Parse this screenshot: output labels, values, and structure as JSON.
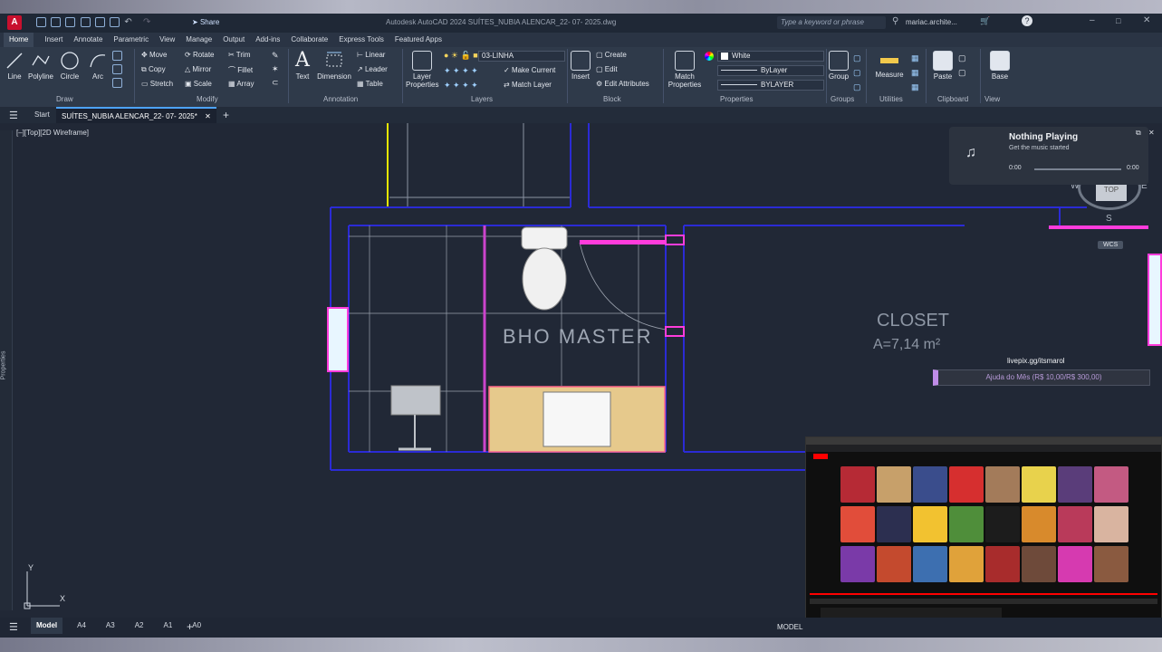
{
  "app": {
    "logo_letter": "A",
    "title": "Autodesk AutoCAD 2024   SUÍTES_NUBIA ALENCAR_22- 07- 2025.dwg",
    "search_placeholder": "Type a keyword or phrase",
    "user": "mariac.archite...",
    "share_label": "Share"
  },
  "ribbon_tabs": [
    "Home",
    "Insert",
    "Annotate",
    "Parametric",
    "View",
    "Manage",
    "Output",
    "Add-ins",
    "Collaborate",
    "Express Tools",
    "Featured Apps"
  ],
  "active_tab": "Home",
  "draw": {
    "line": "Line",
    "polyline": "Polyline",
    "circle": "Circle",
    "arc": "Arc",
    "panel": "Draw"
  },
  "modify": {
    "move": "Move",
    "rotate": "Rotate",
    "trim": "Trim",
    "copy": "Copy",
    "mirror": "Mirror",
    "fillet": "Fillet",
    "stretch": "Stretch",
    "scale": "Scale",
    "array": "Array",
    "panel": "Modify"
  },
  "annotation": {
    "text": "Text",
    "dimension": "Dimension",
    "linear": "Linear",
    "leader": "Leader",
    "table": "Table",
    "panel": "Annotation"
  },
  "layers": {
    "layer_properties": "Layer Properties",
    "current_layer": "03-LINHA",
    "make_current": "Make Current",
    "match_layer": "Match Layer",
    "panel": "Layers"
  },
  "block": {
    "insert": "Insert",
    "create": "Create",
    "edit": "Edit",
    "edit_attributes": "Edit Attributes",
    "panel": "Block"
  },
  "properties": {
    "match_properties": "Match Properties",
    "color": "White",
    "linetype": "ByLayer",
    "lineweight": "BYLAYER",
    "panel": "Properties"
  },
  "groups": {
    "group": "Group",
    "panel": "Groups"
  },
  "utilities": {
    "measure": "Measure",
    "panel": "Utilities"
  },
  "clipboard": {
    "paste": "Paste",
    "panel": "Clipboard"
  },
  "view": {
    "base": "Base",
    "panel": "View"
  },
  "doc_tabs": {
    "start": "Start",
    "file": "SUÍTES_NUBIA ALENCAR_22- 07- 2025*"
  },
  "viewport_label": "[–][Top][2D Wireframe]",
  "side_palette": "Properties",
  "drawing": {
    "room_name": "BHO MASTER",
    "closet_name": "CLOSET",
    "closet_area": "A=7,14  m²"
  },
  "viewcube": {
    "top": "TOP",
    "west": "W",
    "east": "E",
    "south": "S",
    "wcs": "WCS"
  },
  "music": {
    "title": "Nothing Playing",
    "subtitle": "Get the music started",
    "time_start": "0:00",
    "time_end": "0:00"
  },
  "stream": {
    "link": "livepix.gg/itsmarol",
    "goal": "Ajuda do Mês (R$ 10,00/R$ 300,00)"
  },
  "layout_tabs": [
    "Model",
    "A4",
    "A3",
    "A2",
    "A1",
    "A0"
  ],
  "status": {
    "model": "MODEL"
  },
  "ucs": {
    "x": "X",
    "y": "Y"
  },
  "colors": {
    "accent": "#4da3ff",
    "magenta": "#ff3cdc",
    "wall": "#2b2bd6",
    "floor": "#e6c98c"
  }
}
